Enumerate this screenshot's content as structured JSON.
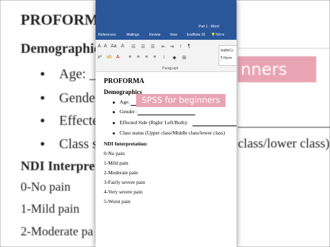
{
  "background": {
    "title": "PROFORMA",
    "demographics": "Demographics",
    "age_prefix": "Age: _",
    "gender_prefix": "Gende",
    "effected_prefix": "Effecte",
    "class_prefix": "Class s",
    "class_suffix": "class/lower class)",
    "ndi_prefix": "NDI Interpre",
    "pain_0": "0-No pain",
    "pain_1": "1-Mild pain",
    "pain_2": "2-Moderate pa",
    "badge_text": "nners"
  },
  "window": {
    "doc_title": "Part 1 - Word",
    "tabs": [
      "References",
      "Mailings",
      "Review",
      "View",
      "EndNote 20",
      "Tell m"
    ],
    "group_label": "Paragraph",
    "style_sample": "AaBbCc",
    "style_name": "¶ Norm"
  },
  "document": {
    "title": "PROFORMA",
    "section": "Demographics",
    "fields": {
      "age": "Age: ",
      "gender": "Gender",
      "effected_side": "Effected Side (Right/ Left/Both):",
      "class_status": "Class status (Upper class/Middle class/lower class)"
    },
    "ndi_heading": "NDI Interpretation:",
    "pain_scale": [
      "0-No pain",
      "1-Mild pain",
      "2-Moderate pain",
      "3-Fairly severe pain",
      "4-Very severe pain",
      "5-Worst pain"
    ]
  },
  "overlay": {
    "label": "SPSS for beginners"
  }
}
